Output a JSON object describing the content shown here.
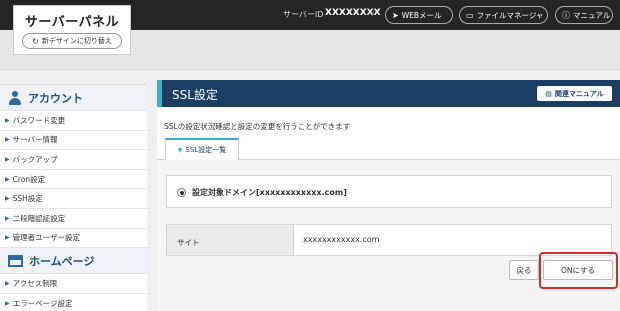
{
  "header": {
    "logo_title": "サーバーパネル",
    "new_design_button": "新デザインに切り替え",
    "server_id_label": "サーバーID",
    "server_id_value": "XXXXXXXX",
    "separator": "/",
    "web_mail": "WEBメール",
    "file_manager": "ファイルマネージャ",
    "manual": "マニュアル"
  },
  "sidebar": {
    "sections": [
      {
        "title": "アカウント",
        "items": [
          "パスワード変更",
          "サーバー情報",
          "バックアップ",
          "Cron設定",
          "SSH設定",
          "二段階認証設定",
          "管理者ユーザー設定"
        ]
      },
      {
        "title": "ホームページ",
        "items": [
          "アクセス制限",
          "エラーページ設定"
        ]
      }
    ]
  },
  "main": {
    "title": "SSL設定",
    "related_manual": "関連マニュアル",
    "description": "SSLの設定状況確認と設定の変更を行うことができます",
    "tab_label": "SSL設定一覧",
    "target_domain_label": "設定対象ドメイン[xxxxxxxxxxxx.com]",
    "site_label": "サイト",
    "site_value": "xxxxxxxxxxxx.com",
    "back_button": "戻る",
    "on_button": "ONにする"
  },
  "colors": {
    "header_bg": "#252525",
    "panel_header_bg": "#1d3e63",
    "accent": "#35b4c9",
    "highlight": "#d42a2a"
  }
}
